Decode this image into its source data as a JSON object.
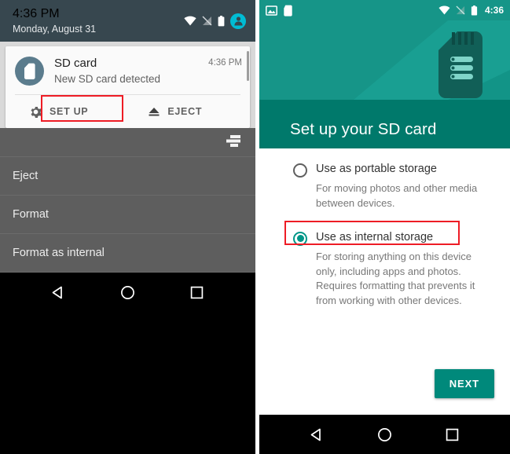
{
  "left_screen": {
    "status_bar": {
      "time": "4:36 PM",
      "date": "Monday, August 31",
      "icons": [
        "wifi-icon",
        "no-signal-icon",
        "battery-icon",
        "user-avatar-icon"
      ]
    },
    "notification": {
      "icon": "sd-card-icon",
      "title": "SD card",
      "subtitle": "New SD card detected",
      "time": "4:36 PM",
      "actions": [
        {
          "icon": "gear-icon",
          "label": "SET UP",
          "highlighted": true
        },
        {
          "icon": "eject-icon",
          "label": "EJECT",
          "highlighted": false
        }
      ]
    },
    "menu": {
      "clear_icon": "clear-all-icon",
      "items": [
        "Eject",
        "Format",
        "Format as internal"
      ]
    },
    "nav_bar": [
      "back-icon",
      "home-icon",
      "recents-icon"
    ]
  },
  "right_screen": {
    "status_bar": {
      "left_icons": [
        "screenshot-icon",
        "sd-card-icon"
      ],
      "right_icons": [
        "wifi-icon",
        "no-signal-icon",
        "battery-icon"
      ],
      "time": "4:36"
    },
    "hero": {
      "title": "Set up your SD card",
      "illustration": "sd-card-illustration"
    },
    "options": [
      {
        "label": "Use as portable storage",
        "description": "For moving photos and other media between devices.",
        "selected": false,
        "highlighted": false
      },
      {
        "label": "Use as internal storage",
        "description": "For storing anything on this device only, including apps and photos. Requires formatting that prevents it from working with other devices.",
        "selected": true,
        "highlighted": true
      }
    ],
    "next_button": "NEXT",
    "nav_bar": [
      "back-icon",
      "home-icon",
      "recents-icon"
    ]
  },
  "colors": {
    "teal_primary": "#169588",
    "teal_dark": "#00796b",
    "teal_accent": "#009688",
    "button_teal": "#00897b",
    "status_bar_dark": "#37474f",
    "scrim_grey": "#5e5e5e",
    "annotation_red": "#ee1c25",
    "avatar_cyan": "#00bcd4"
  }
}
